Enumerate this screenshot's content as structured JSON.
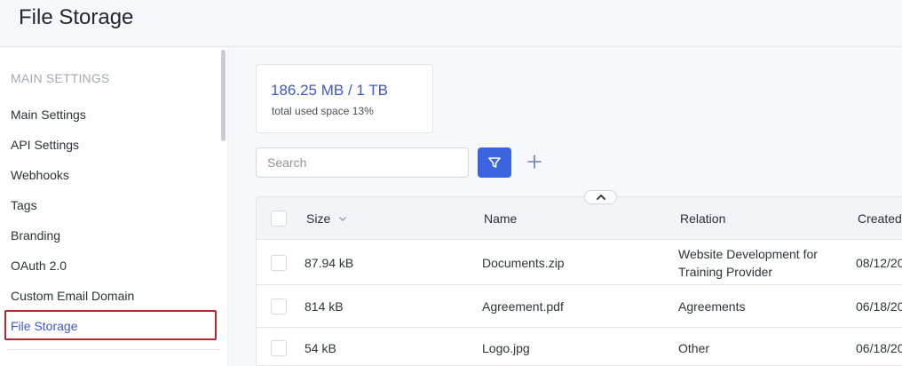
{
  "header": {
    "title": "File Storage"
  },
  "sidebar": {
    "section_title": "MAIN SETTINGS",
    "items": [
      {
        "label": "Main Settings"
      },
      {
        "label": "API Settings"
      },
      {
        "label": "Webhooks"
      },
      {
        "label": "Tags"
      },
      {
        "label": "Branding"
      },
      {
        "label": "OAuth 2.0"
      },
      {
        "label": "Custom Email Domain"
      },
      {
        "label": "File Storage",
        "active": true
      }
    ]
  },
  "storage": {
    "used_label": "186.25 MB / 1 TB",
    "subtitle": "total used space 13%"
  },
  "toolbar": {
    "search_placeholder": "Search",
    "filter_icon": "filter-icon",
    "add_icon": "plus-icon"
  },
  "table": {
    "columns": [
      "Size",
      "Name",
      "Relation",
      "Created"
    ],
    "rows": [
      {
        "size": "87.94 kB",
        "name": "Documents.zip",
        "relation": "Website Development for Training Provider",
        "created": "08/12/20"
      },
      {
        "size": "814 kB",
        "name": "Agreement.pdf",
        "relation": "Agreements",
        "created": "06/18/20"
      },
      {
        "size": "54 kB",
        "name": "Logo.jpg",
        "relation": "Other",
        "created": "06/18/20"
      }
    ]
  },
  "colors": {
    "accent": "#3c64e0",
    "active_text": "#3b5bd0",
    "highlight_border": "#b02a2f"
  }
}
